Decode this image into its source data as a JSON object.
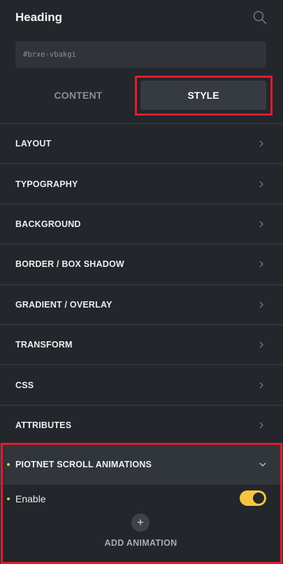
{
  "header": {
    "title": "Heading",
    "search_icon": "search-icon"
  },
  "id_field": {
    "value": "#brxe-vbakgi"
  },
  "tabs": [
    {
      "label": "CONTENT",
      "active": false
    },
    {
      "label": "STYLE",
      "active": true
    }
  ],
  "sections": [
    {
      "label": "LAYOUT"
    },
    {
      "label": "TYPOGRAPHY"
    },
    {
      "label": "BACKGROUND"
    },
    {
      "label": "BORDER / BOX SHADOW"
    },
    {
      "label": "GRADIENT / OVERLAY"
    },
    {
      "label": "TRANSFORM"
    },
    {
      "label": "CSS"
    },
    {
      "label": "ATTRIBUTES"
    }
  ],
  "animations": {
    "label": "PIOTNET SCROLL ANIMATIONS",
    "expanded": true,
    "enable_label": "Enable",
    "enabled": true,
    "add_icon": "+",
    "add_label": "ADD ANIMATION"
  },
  "colors": {
    "background": "#23262b",
    "accent": "#f5c542",
    "highlight": "#e11c2a"
  }
}
